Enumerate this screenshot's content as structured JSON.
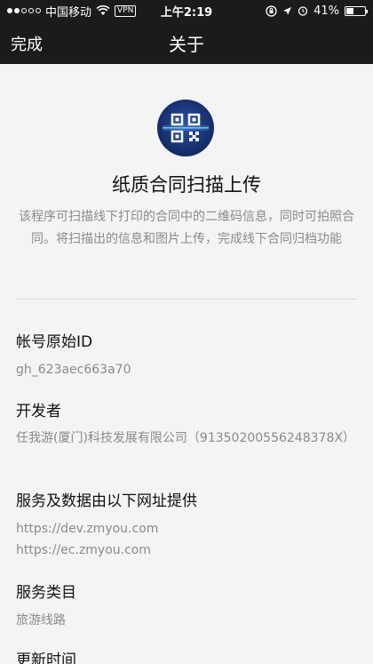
{
  "status_bar": {
    "carrier": "中国移动",
    "vpn": "VPN",
    "time": "上午2:19",
    "battery": "41%",
    "battery_level": 0.41
  },
  "nav": {
    "done": "完成",
    "title": "关于"
  },
  "app": {
    "name": "纸质合同扫描上传",
    "description": "该程序可扫描线下打印的合同中的二维码信息，同时可拍照合同。将扫描出的信息和图片上传，完成线下合同归档功能"
  },
  "sections": {
    "original_id": {
      "label": "帐号原始ID",
      "value": "gh_623aec663a70"
    },
    "developer": {
      "label": "开发者",
      "value": "任我游(厦门)科技发展有限公司（91350200556248378X）"
    },
    "services": {
      "label": "服务及数据由以下网址提供",
      "urls": [
        "https://dev.zmyou.com",
        "https://ec.zmyou.com"
      ]
    },
    "category": {
      "label": "服务类目",
      "value": "旅游线路"
    },
    "updated": {
      "label": "更新时间"
    }
  },
  "colors": {
    "bar": "#1b1b1b",
    "background": "#f4f4f4",
    "secondary_text": "#8a8a8a",
    "logo": "#142a66"
  }
}
